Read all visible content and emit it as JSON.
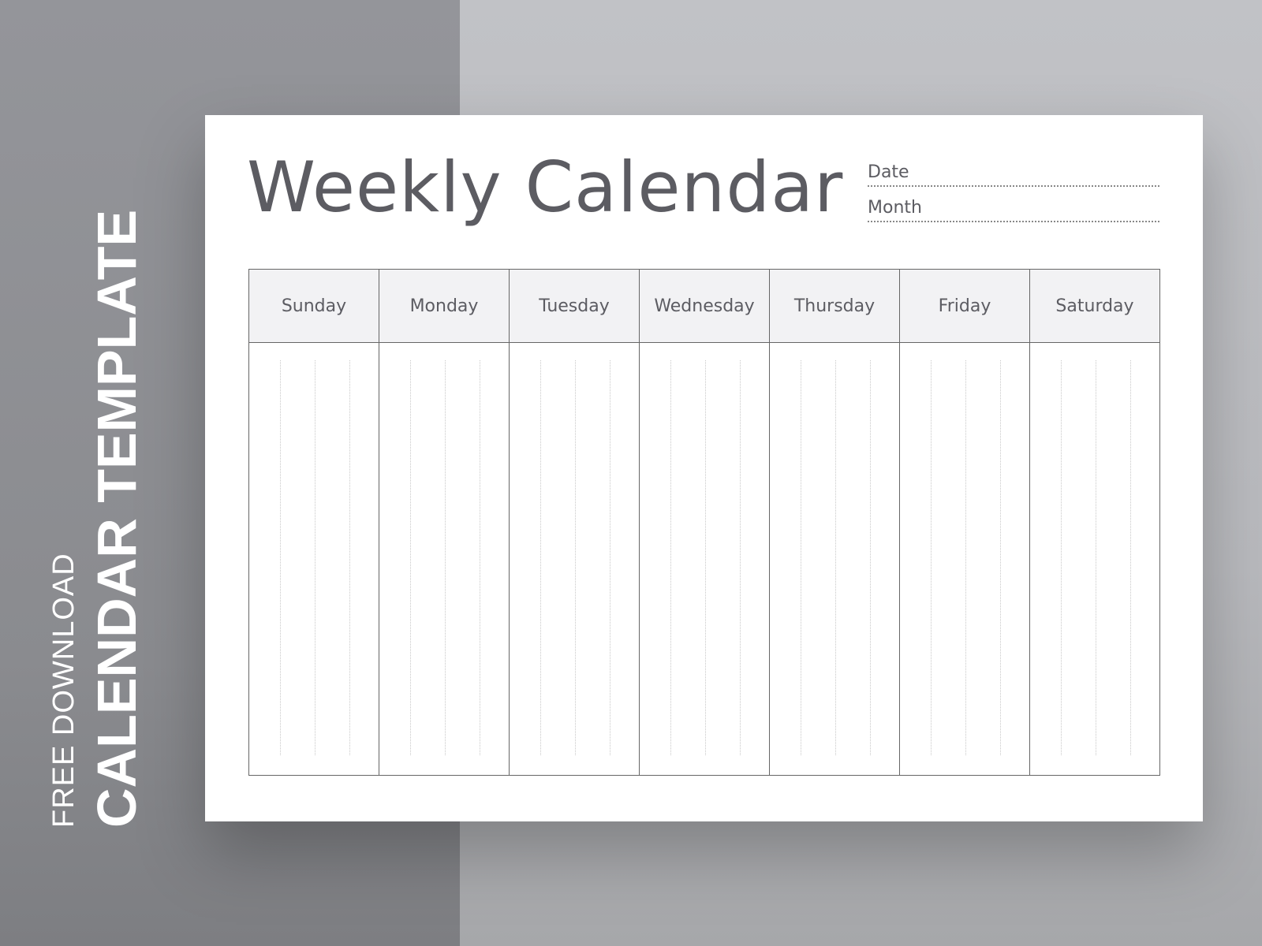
{
  "banner": {
    "line1": "FREE DOWNLOAD",
    "line2": "CALENDAR TEMPLATE"
  },
  "card": {
    "title": "Weekly Calendar",
    "fields": [
      {
        "label": "Date"
      },
      {
        "label": "Month"
      }
    ],
    "days": [
      "Sunday",
      "Monday",
      "Tuesday",
      "Wednesday",
      "Thursday",
      "Friday",
      "Saturday"
    ]
  }
}
